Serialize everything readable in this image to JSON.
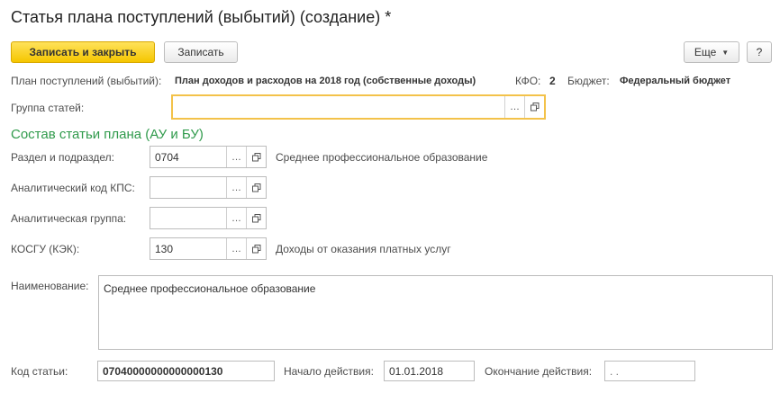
{
  "title": "Статья плана поступлений (выбытий) (создание) *",
  "toolbar": {
    "save_close": "Записать и закрыть",
    "save": "Записать",
    "more": "Еще",
    "help": "?"
  },
  "plan": {
    "label": "План поступлений (выбытий):",
    "value": "План доходов и расходов на 2018 год (собственные доходы)",
    "kfo_label": "КФО:",
    "kfo_value": "2",
    "budget_label": "Бюджет:",
    "budget_value": "Федеральный бюджет"
  },
  "group": {
    "label": "Группа статей:",
    "value": ""
  },
  "section_title": "Состав статьи плана (АУ и БУ)",
  "fields": {
    "razdel": {
      "label": "Раздел и подраздел:",
      "value": "0704",
      "desc": "Среднее профессиональное образование"
    },
    "kps": {
      "label": "Аналитический код КПС:",
      "value": ""
    },
    "analytic_group": {
      "label": "Аналитическая группа:",
      "value": ""
    },
    "kosgu": {
      "label": "КОСГУ (КЭК):",
      "value": "130",
      "desc": "Доходы от оказания платных услуг"
    }
  },
  "name": {
    "label": "Наименование:",
    "value": "Среднее профессиональное образование"
  },
  "code": {
    "label": "Код статьи:",
    "value": "07040000000000000130"
  },
  "start": {
    "label": "Начало действия:",
    "value": "01.01.2018"
  },
  "end": {
    "label": "Окончание действия:",
    "value": " .  ."
  },
  "icons": {
    "select": "…",
    "open": "open-window-icon"
  }
}
